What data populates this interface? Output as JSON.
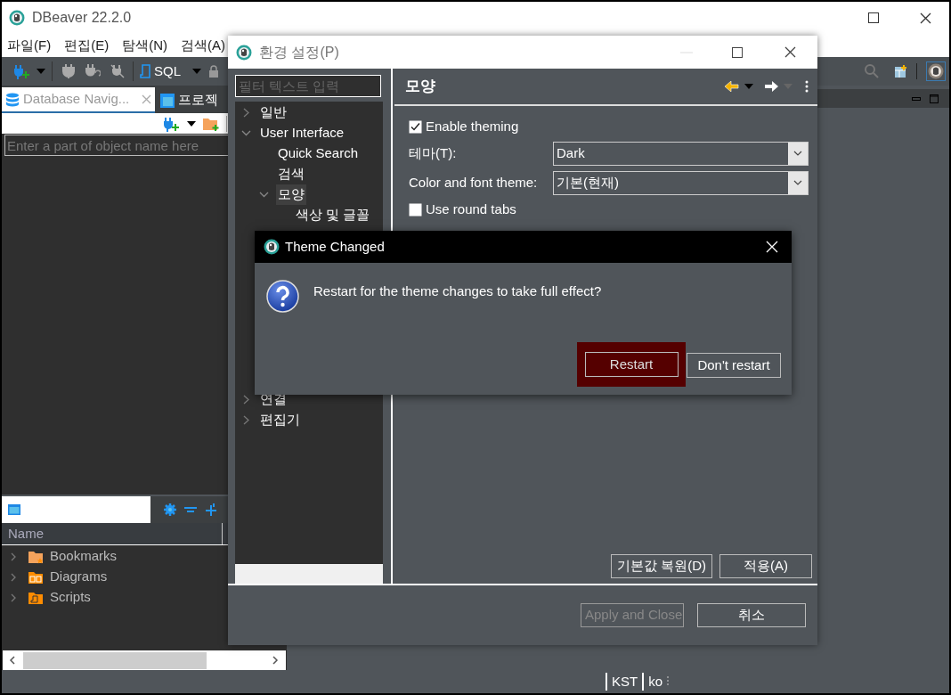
{
  "window": {
    "title": "DBeaver 22.2.0"
  },
  "menu": [
    "파일(F)",
    "편집(E)",
    "탐색(N)",
    "검색(A)"
  ],
  "toolbar": {
    "sql_label": "SQL"
  },
  "navigator": {
    "tabs": [
      {
        "label": "Database Navig...",
        "selected": true
      },
      {
        "label": "프로젝",
        "selected": false
      }
    ],
    "filter": {
      "placeholder": "Enter a part of object name here"
    }
  },
  "projects": {
    "column": "Name",
    "items": [
      {
        "label": "Bookmarks",
        "kind": "bookmarks"
      },
      {
        "label": "Diagrams",
        "kind": "diagrams"
      },
      {
        "label": "Scripts",
        "kind": "scripts"
      }
    ]
  },
  "status_bar": [
    "KST",
    "ko"
  ],
  "preferences": {
    "title": "환경 설정(P)",
    "filter": {
      "placeholder": "필터 텍스트 입력"
    },
    "tree": [
      {
        "label": "일반",
        "expanded": false,
        "selected": false
      },
      {
        "label": "User Interface",
        "expanded": true,
        "selected": false,
        "children": [
          {
            "label": "Quick Search",
            "selected": false
          },
          {
            "label": "검색",
            "selected": false
          },
          {
            "label": "모양",
            "expanded": true,
            "selected": true,
            "children": [
              {
                "label": "색상 및 글꼴",
                "selected": false
              }
            ]
          }
        ]
      },
      {
        "label": "연결",
        "expanded": false,
        "selected": false
      },
      {
        "label": "편집기",
        "expanded": false,
        "selected": false
      }
    ],
    "page": {
      "title": "모양",
      "options": [
        {
          "kind": "checkbox",
          "label": "Enable theming",
          "checked": true
        },
        {
          "kind": "select",
          "label": "테마(T):",
          "value": "Dark"
        },
        {
          "kind": "select",
          "label": "Color and font theme:",
          "value": "기본(현재)"
        },
        {
          "kind": "checkbox",
          "label": "Use round tabs",
          "checked": false
        }
      ],
      "buttons": [
        "기본값 복원(D)",
        "적용(A)"
      ]
    },
    "buttons": [
      {
        "label": "Apply and Close",
        "disabled": true
      },
      {
        "label": "취소",
        "disabled": false
      }
    ]
  },
  "dialog": {
    "title": "Theme Changed",
    "message": "Restart for the theme changes to take full effect?",
    "buttons": [
      {
        "label": "Restart",
        "default": true
      },
      {
        "label": "Don't restart",
        "default": false
      }
    ]
  }
}
